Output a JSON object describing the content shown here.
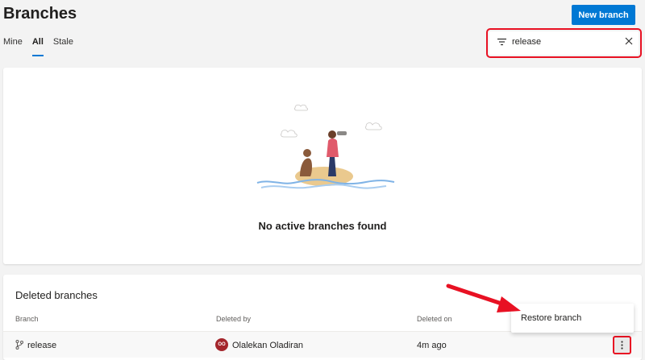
{
  "header": {
    "title": "Branches",
    "new_branch_label": "New branch"
  },
  "tabs": [
    {
      "label": "Mine",
      "active": false
    },
    {
      "label": "All",
      "active": true
    },
    {
      "label": "Stale",
      "active": false
    }
  ],
  "filter": {
    "value": "release",
    "icon": "filter-icon",
    "clear_icon": "close-icon"
  },
  "empty_state": {
    "message": "No active branches found"
  },
  "deleted_branches": {
    "title": "Deleted branches",
    "columns": [
      "Branch",
      "Deleted by",
      "Deleted on"
    ],
    "rows": [
      {
        "branch": "release",
        "deleted_by": "Olalekan Oladiran",
        "avatar_initials": "OO",
        "deleted_on": "4m ago"
      }
    ]
  },
  "context_menu": {
    "items": [
      {
        "label": "Restore branch"
      }
    ]
  },
  "colors": {
    "accent": "#0078d4",
    "highlight": "#e81123",
    "avatar": "#a4262c"
  }
}
